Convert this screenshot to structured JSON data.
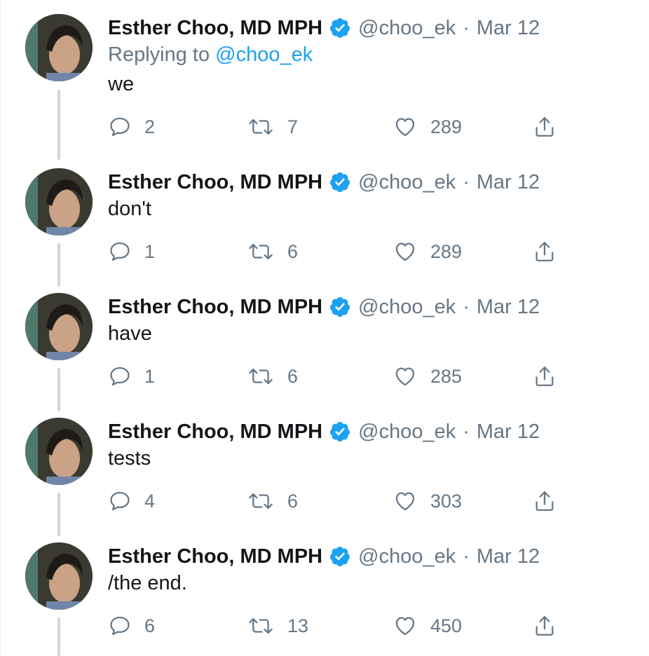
{
  "tweets": [
    {
      "author": "Esther Choo, MD MPH",
      "handle": "@choo_ek",
      "separator": "·",
      "date": "Mar 12",
      "replying_prefix": "Replying to ",
      "replying_to": "@choo_ek",
      "text": "we",
      "replies": "2",
      "retweets": "7",
      "likes": "289"
    },
    {
      "author": "Esther Choo, MD MPH",
      "handle": "@choo_ek",
      "separator": "·",
      "date": "Mar 12",
      "text": "don't",
      "replies": "1",
      "retweets": "6",
      "likes": "289"
    },
    {
      "author": "Esther Choo, MD MPH",
      "handle": "@choo_ek",
      "separator": "·",
      "date": "Mar 12",
      "text": "have",
      "replies": "1",
      "retweets": "6",
      "likes": "285"
    },
    {
      "author": "Esther Choo, MD MPH",
      "handle": "@choo_ek",
      "separator": "·",
      "date": "Mar 12",
      "text": "tests",
      "replies": "4",
      "retweets": "6",
      "likes": "303"
    },
    {
      "author": "Esther Choo, MD MPH",
      "handle": "@choo_ek",
      "separator": "·",
      "date": "Mar 12",
      "text": "/the end.",
      "replies": "6",
      "retweets": "13",
      "likes": "450"
    }
  ],
  "icons": {
    "reply": "reply-icon",
    "retweet": "retweet-icon",
    "like": "heart-icon",
    "share": "share-icon",
    "verified": "verified-badge-icon"
  },
  "colors": {
    "text": "#14171a",
    "secondary": "#657786",
    "link": "#1da1f2",
    "verified": "#1da1f2",
    "thread_line": "#ccd6dd"
  }
}
